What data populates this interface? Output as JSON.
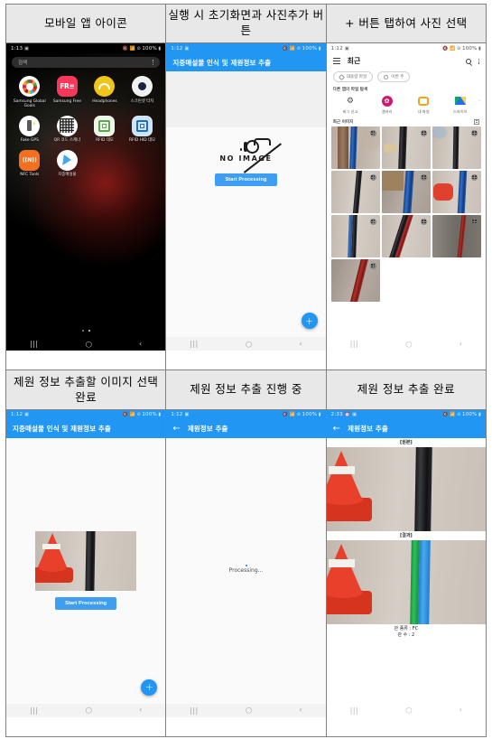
{
  "figure": {
    "rows": [
      {
        "cells": [
          {
            "caption": "모바일 앱 아이콘"
          },
          {
            "caption": "실행 시 초기화면과 사진추가 버튼"
          },
          {
            "caption": "+ 버튼 탭하여 사진 선택"
          }
        ]
      },
      {
        "cells": [
          {
            "caption": "제원 정보 추출할 이미지 선택 완료"
          },
          {
            "caption": "제원 정보 추출 진행 중"
          },
          {
            "caption": "제원 정보 추출 완료"
          }
        ]
      }
    ]
  },
  "launcher": {
    "status": {
      "time": "1:13",
      "battery": "100%"
    },
    "search_placeholder": "검색",
    "apps": [
      {
        "label": "Samsung Global Goals",
        "icon": "sdg-icon"
      },
      {
        "label": "Samsung Free",
        "icon": "free-icon"
      },
      {
        "label": "Headphones",
        "icon": "headphones-icon"
      },
      {
        "label": "스크린샷 터치",
        "icon": "screenshot-touch-icon"
      },
      {
        "label": "Fake GPS",
        "icon": "fake-gps-icon"
      },
      {
        "label": "QR 코드 스캐너",
        "icon": "qr-scanner-icon"
      },
      {
        "label": "RFID 데모",
        "icon": "rfid-demo-icon"
      },
      {
        "label": "RFID HID 데모",
        "icon": "rfid-hid-demo-icon"
      },
      {
        "label": "NFC Tools",
        "icon": "nfc-tools-icon"
      },
      {
        "label": "지중매설물",
        "icon": "flutter-app-icon"
      }
    ]
  },
  "app_home": {
    "status": {
      "time": "1:12",
      "battery": "100%"
    },
    "title": "지중매설물 인식 및 제원정보 추출",
    "empty_state": "NO IMAGE",
    "start_button": "Start Processing",
    "fab_label": "+"
  },
  "app_selected": {
    "status": {
      "time": "1:12",
      "battery": "100%"
    },
    "title": "지중매설물 인식 및 제원정보 추출",
    "start_button": "Start Processing",
    "fab_label": "+"
  },
  "picker": {
    "status": {
      "time": "1:12",
      "battery": "100%"
    },
    "title": "최근",
    "chips": [
      {
        "label": "대용량 파일",
        "icon": "tag-icon"
      },
      {
        "label": "이번 주",
        "icon": "clock-icon"
      }
    ],
    "browse_section_title": "다른 앱의 파일 탐색",
    "apps": [
      {
        "label": "버그 신고",
        "icon": "bug-report-icon"
      },
      {
        "label": "갤러리",
        "icon": "gallery-icon"
      },
      {
        "label": "내 파일",
        "icon": "my-files-icon"
      },
      {
        "label": "드라이브",
        "icon": "google-drive-icon"
      }
    ],
    "recent_section_title": "최근 이미지",
    "thumbnail_count": 10
  },
  "processing": {
    "status": {
      "time": "1:12",
      "battery": "100%"
    },
    "title": "제원정보 추출",
    "text": "Processing..."
  },
  "result": {
    "status": {
      "time": "2:33",
      "battery": "100%"
    },
    "title": "제원정보 추출",
    "original_label": "[원본]",
    "result_label": "[결과]",
    "meta": {
      "pipe_type": "관 종류 : FC",
      "pipe_count": "관 수 : 2"
    }
  },
  "navbar": {
    "recents": "|||",
    "home": "◯",
    "back": "‹"
  },
  "colors": {
    "accent_blue": "#2196f3",
    "button_blue": "#3f9ef1",
    "pipe_green": "#2fc158",
    "pipe_cyan": "#4aa8ef",
    "cone_red": "#e8402a"
  }
}
